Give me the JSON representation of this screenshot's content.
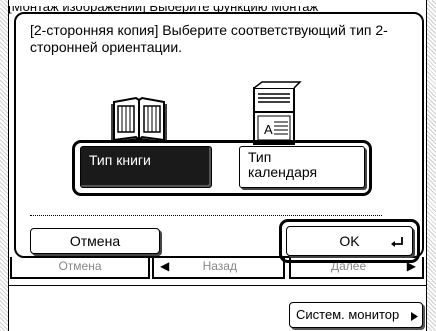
{
  "background": {
    "title": "[Монтаж изображений] Выберите функцию Монтаж",
    "cancel_label": "Отмена",
    "back_label": "Назад",
    "next_label": "Далее",
    "monitor_label": "Систем. монитор"
  },
  "dialog": {
    "message": "[2-сторонняя копия] Выберите соответствующий тип 2-сторонней ориентации.",
    "options": [
      {
        "label": "Тип книги",
        "selected": true,
        "icon": "book-icon"
      },
      {
        "label_line1": "Тип",
        "label_line2": "календаря",
        "selected": false,
        "icon": "calendar-icon"
      }
    ],
    "cancel_label": "Отмена",
    "ok_label": "OK"
  }
}
